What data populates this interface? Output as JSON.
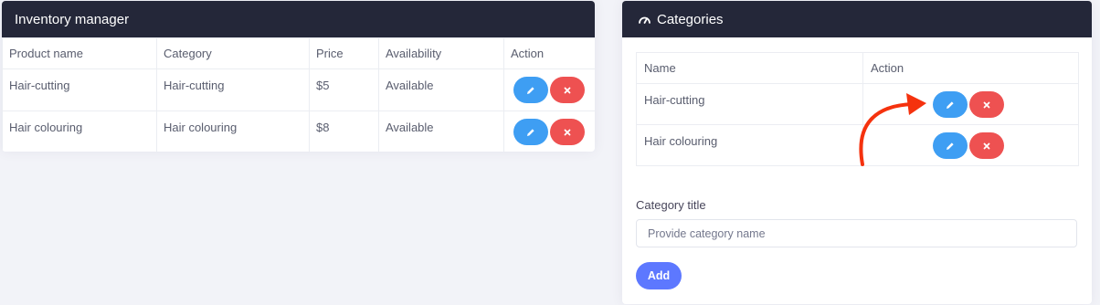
{
  "inventory": {
    "title": "Inventory manager",
    "columns": [
      "Product name",
      "Category",
      "Price",
      "Availability",
      "Action"
    ],
    "rows": [
      {
        "product": "Hair-cutting",
        "category": "Hair-cutting",
        "price": "$5",
        "availability": "Available"
      },
      {
        "product": "Hair colouring",
        "category": "Hair colouring",
        "price": "$8",
        "availability": "Available"
      }
    ]
  },
  "categories": {
    "title": "Categories",
    "icon": "speedometer-icon",
    "columns": [
      "Name",
      "Action"
    ],
    "rows": [
      {
        "name": "Hair-cutting"
      },
      {
        "name": "Hair colouring"
      }
    ],
    "form": {
      "label": "Category title",
      "placeholder": "Provide category name",
      "value": "",
      "add_label": "Add"
    }
  },
  "annotation": {
    "type": "red-curved-arrow",
    "color": "#f5320e",
    "points_to": "first category edit button"
  },
  "colors": {
    "header_bg": "#242739",
    "edit_button": "#3e9ef3",
    "delete_button": "#ee5151",
    "add_button": "#5d78ff",
    "page_bg": "#f2f3f8"
  }
}
